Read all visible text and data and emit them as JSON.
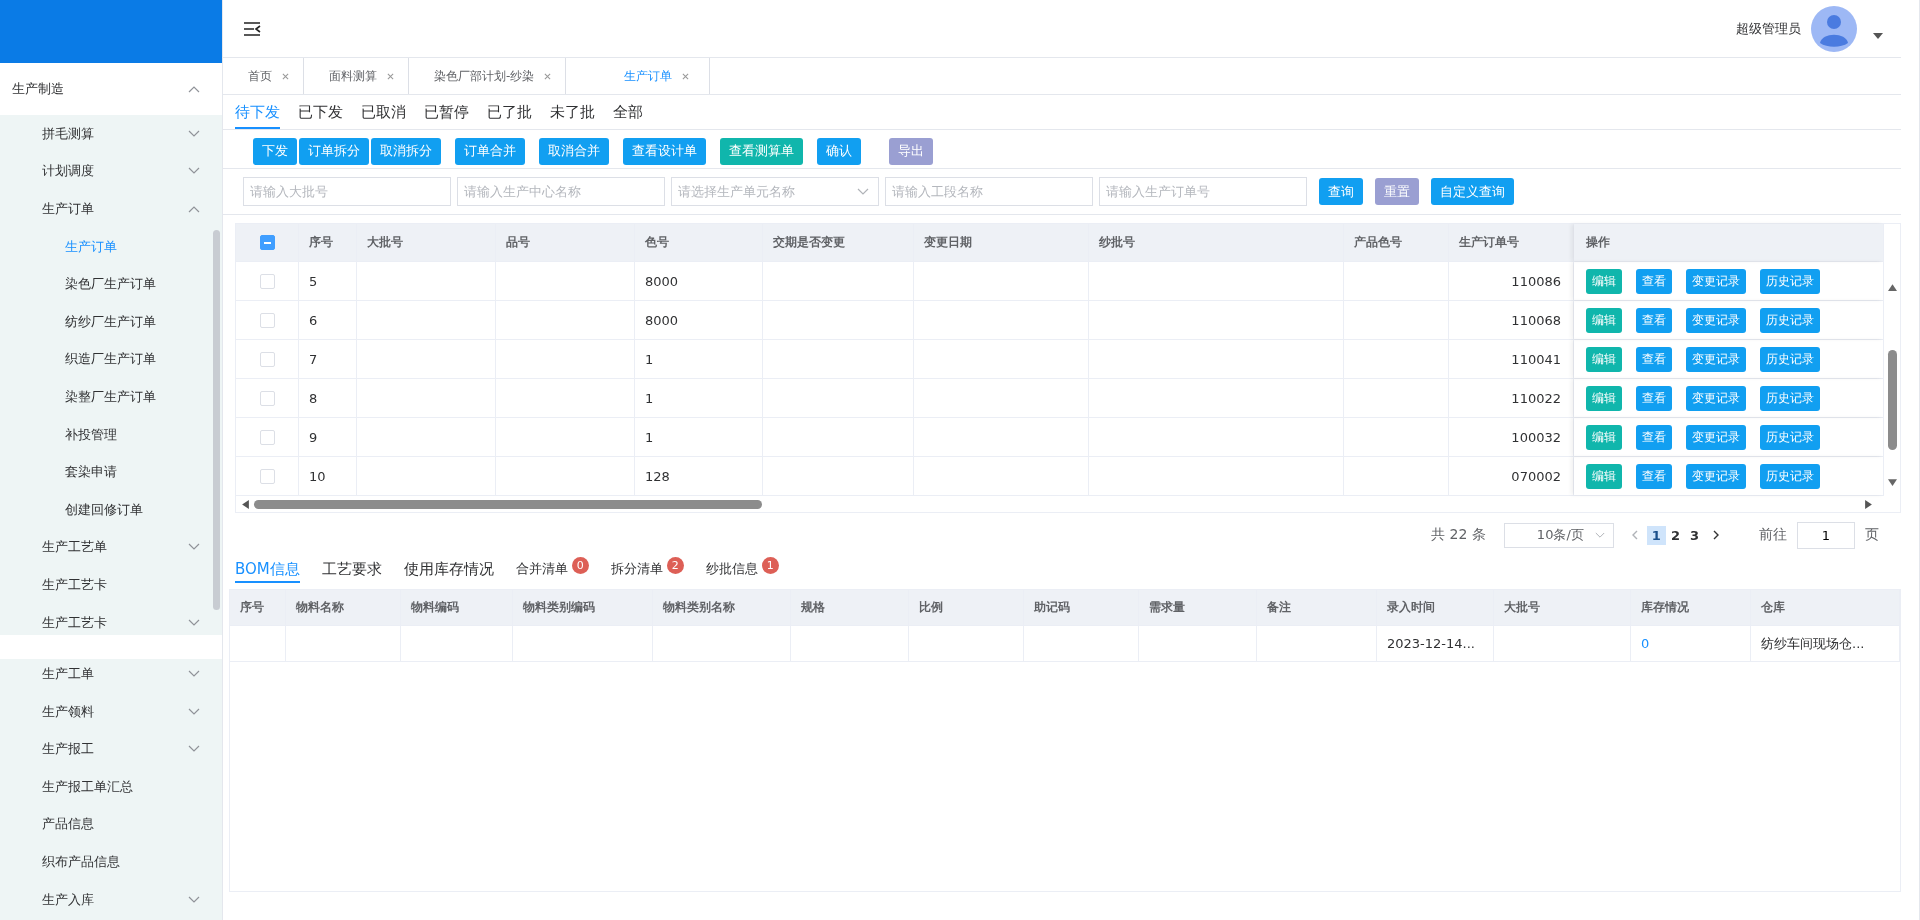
{
  "sidebar": {
    "items": [
      {
        "label": "生产制造",
        "kind": "group",
        "expanded": true,
        "children": [
          {
            "label": "拼毛测算",
            "kind": "group",
            "expanded": false,
            "selected": false
          },
          {
            "label": "计划调度",
            "kind": "group",
            "expanded": false,
            "selected": false
          },
          {
            "label": "生产订单",
            "kind": "group",
            "expanded": true,
            "selected": false,
            "children": [
              {
                "label": "生产订单",
                "selected": true
              },
              {
                "label": "染色厂生产订单",
                "selected": false
              },
              {
                "label": "纺纱厂生产订单",
                "selected": false
              },
              {
                "label": "织造厂生产订单",
                "selected": false
              },
              {
                "label": "染整厂生产订单",
                "selected": false
              },
              {
                "label": "补投管理",
                "selected": false
              },
              {
                "label": "套染申请",
                "selected": false
              },
              {
                "label": "创建回修订单",
                "selected": false
              }
            ]
          },
          {
            "label": "生产工艺单",
            "kind": "group",
            "expanded": false,
            "selected": false
          },
          {
            "label": "生产工艺卡",
            "kind": "link",
            "selected": false
          },
          {
            "label": "生产工艺卡",
            "kind": "group",
            "expanded": false,
            "selected": false
          },
          {
            "label": "生产工单",
            "kind": "group",
            "expanded": false,
            "selected": false
          },
          {
            "label": "生产领料",
            "kind": "group",
            "expanded": false,
            "selected": false
          },
          {
            "label": "生产报工",
            "kind": "group",
            "expanded": false,
            "selected": false
          },
          {
            "label": "生产报工单汇总",
            "kind": "link",
            "selected": false
          },
          {
            "label": "产品信息",
            "kind": "link",
            "selected": false
          },
          {
            "label": "织布产品信息",
            "kind": "link",
            "selected": false
          },
          {
            "label": "生产入库",
            "kind": "group",
            "expanded": false,
            "selected": false
          }
        ]
      }
    ]
  },
  "header": {
    "user": "超级管理员"
  },
  "page_tabs": [
    {
      "label": "首页",
      "selected": false
    },
    {
      "label": "面料测算",
      "selected": false
    },
    {
      "label": "染色厂部计划-纱染",
      "selected": false
    },
    {
      "label": "生产订单",
      "selected": true
    }
  ],
  "status_tabs": [
    {
      "label": "待下发",
      "selected": true
    },
    {
      "label": "已下发",
      "selected": false
    },
    {
      "label": "已取消",
      "selected": false
    },
    {
      "label": "已暂停",
      "selected": false
    },
    {
      "label": "已了批",
      "selected": false
    },
    {
      "label": "未了批",
      "selected": false
    },
    {
      "label": "全部",
      "selected": false
    }
  ],
  "toolbar": [
    {
      "label": "下发",
      "kind": "primary"
    },
    {
      "label": "订单拆分",
      "kind": "primary"
    },
    {
      "label": "取消拆分",
      "kind": "primary"
    },
    {
      "label": "订单合并",
      "kind": "primary"
    },
    {
      "label": "取消合并",
      "kind": "primary"
    },
    {
      "label": "查看设计单",
      "kind": "primary"
    },
    {
      "label": "查看测算单",
      "kind": "teal"
    },
    {
      "label": "确认",
      "kind": "primary"
    },
    {
      "label": "导出",
      "kind": "muted"
    }
  ],
  "filters": [
    {
      "placeholder": "请输入大批号",
      "kind": "input"
    },
    {
      "placeholder": "请输入生产中心名称",
      "kind": "input"
    },
    {
      "placeholder": "请选择生产单元名称",
      "kind": "select"
    },
    {
      "placeholder": "请输入工段名称",
      "kind": "input"
    },
    {
      "placeholder": "请输入生产订单号",
      "kind": "input"
    }
  ],
  "filter_buttons": [
    {
      "label": "查询",
      "kind": "primary"
    },
    {
      "label": "重置",
      "kind": "muted"
    },
    {
      "label": "自定义查询",
      "kind": "primary"
    }
  ],
  "table": {
    "select_all": {
      "indeterminate": true
    },
    "columns": [
      "序号",
      "大批号",
      "品号",
      "色号",
      "交期是否变更",
      "变更日期",
      "纱批号",
      "产品色号",
      "生产订单号",
      "操作"
    ],
    "rows": [
      {
        "checked": false,
        "no": "5",
        "color_no": "8000",
        "order_no": "110086",
        "actions": [
          {
            "label": "编辑",
            "kind": "teal"
          },
          {
            "label": "查看",
            "kind": "primary"
          },
          {
            "label": "变更记录",
            "kind": "primary"
          },
          {
            "label": "历史记录",
            "kind": "primary"
          }
        ]
      },
      {
        "checked": false,
        "no": "6",
        "color_no": "8000",
        "order_no": "110068",
        "actions": [
          {
            "label": "编辑",
            "kind": "teal"
          },
          {
            "label": "查看",
            "kind": "primary"
          },
          {
            "label": "变更记录",
            "kind": "primary"
          },
          {
            "label": "历史记录",
            "kind": "primary"
          }
        ]
      },
      {
        "checked": false,
        "no": "7",
        "color_no": "1",
        "order_no": "110041",
        "actions": [
          {
            "label": "编辑",
            "kind": "teal"
          },
          {
            "label": "查看",
            "kind": "primary"
          },
          {
            "label": "变更记录",
            "kind": "primary"
          },
          {
            "label": "历史记录",
            "kind": "primary"
          }
        ]
      },
      {
        "checked": false,
        "no": "8",
        "color_no": "1",
        "order_no": "110022",
        "actions": [
          {
            "label": "编辑",
            "kind": "teal"
          },
          {
            "label": "查看",
            "kind": "primary"
          },
          {
            "label": "变更记录",
            "kind": "primary"
          },
          {
            "label": "历史记录",
            "kind": "primary"
          }
        ]
      },
      {
        "checked": false,
        "no": "9",
        "color_no": "1",
        "order_no": "100032",
        "actions": [
          {
            "label": "编辑",
            "kind": "teal"
          },
          {
            "label": "查看",
            "kind": "primary"
          },
          {
            "label": "变更记录",
            "kind": "primary"
          },
          {
            "label": "历史记录",
            "kind": "primary"
          }
        ]
      },
      {
        "checked": false,
        "no": "10",
        "color_no": "128",
        "order_no": "070002",
        "actions": [
          {
            "label": "编辑",
            "kind": "teal"
          },
          {
            "label": "查看",
            "kind": "primary"
          },
          {
            "label": "变更记录",
            "kind": "primary"
          },
          {
            "label": "历史记录",
            "kind": "primary"
          }
        ]
      }
    ]
  },
  "pagination": {
    "total": "共 22 条",
    "page_size": "10条/页",
    "pages": [
      {
        "label": "1",
        "selected": true
      },
      {
        "label": "2",
        "selected": false
      },
      {
        "label": "3",
        "selected": false
      }
    ],
    "goto_label": "前往",
    "goto_value": "1",
    "goto_suffix": "页"
  },
  "detail_tabs": [
    {
      "label": "BOM信息",
      "selected": true
    },
    {
      "label": "工艺要求",
      "selected": false
    },
    {
      "label": "使用库存情况",
      "selected": false
    },
    {
      "label": "合并清单",
      "selected": false,
      "badge": "0"
    },
    {
      "label": "拆分清单",
      "selected": false,
      "badge": "2"
    },
    {
      "label": "纱批信息",
      "selected": false,
      "badge": "1"
    }
  ],
  "bom_table": {
    "columns": [
      "序号",
      "物料名称",
      "物料编码",
      "物料类别编码",
      "物料类别名称",
      "规格",
      "比例",
      "助记码",
      "需求量",
      "备注",
      "录入时间",
      "大批号",
      "库存情况",
      "仓库"
    ],
    "rows": [
      {
        "entry_time": "2023-12-14...",
        "stock": "0",
        "warehouse": "纺纱车间现场仓..."
      }
    ]
  }
}
